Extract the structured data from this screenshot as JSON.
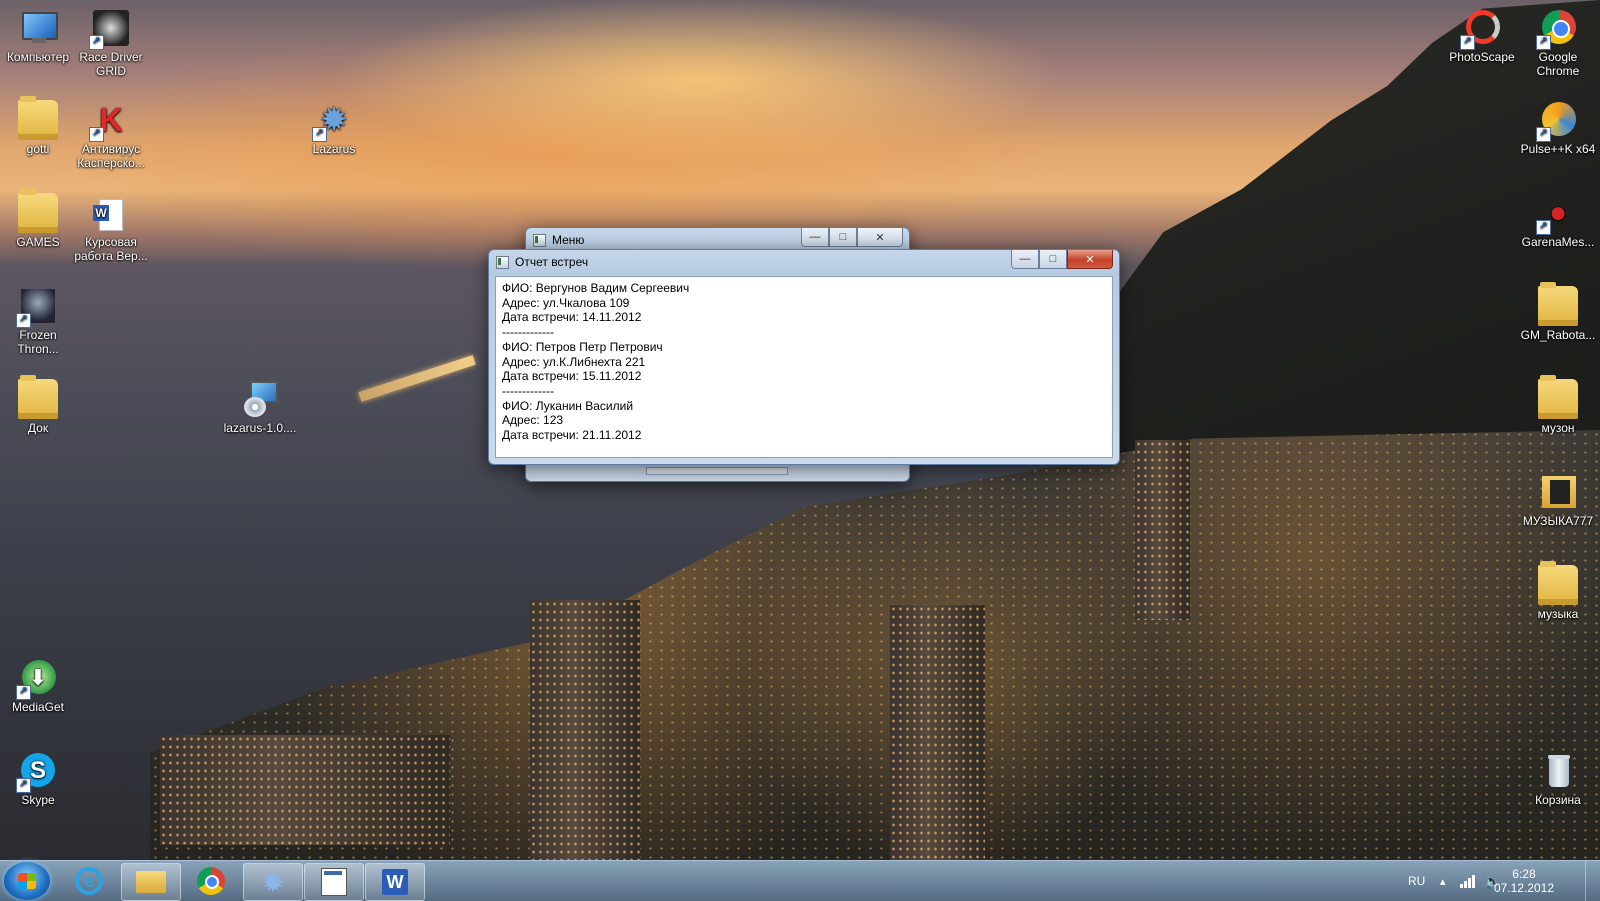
{
  "desktop": {
    "icons_left": [
      {
        "label": "Компьютер"
      },
      {
        "label": "Race Driver GRID"
      },
      {
        "label": "gotti"
      },
      {
        "label": "Антивирус Касперско..."
      },
      {
        "label": "Lazarus"
      },
      {
        "label": "GAMES"
      },
      {
        "label": "Курсовая работа Вер..."
      },
      {
        "label": "Frozen Thron..."
      },
      {
        "label": "Док"
      },
      {
        "label": "lazarus-1.0...."
      },
      {
        "label": "MediaGet"
      },
      {
        "label": "Skype"
      }
    ],
    "icons_right": [
      {
        "label": "PhotoScape"
      },
      {
        "label": "Google Chrome"
      },
      {
        "label": "Pulse++K x64"
      },
      {
        "label": "GarenaMes..."
      },
      {
        "label": "GM_Rabota..."
      },
      {
        "label": "музон"
      },
      {
        "label": "МУЗЫКА777"
      },
      {
        "label": "музыка"
      },
      {
        "label": "Корзина"
      }
    ]
  },
  "window_menu": {
    "title": "Меню"
  },
  "window_report": {
    "title": "Отчет встреч",
    "lines": [
      "ФИО: Вергунов Вадим Сергеевич",
      "Адрес: ул.Чкалова 109",
      "Дата встречи: 14.11.2012",
      "-------------",
      "ФИО: Петров Петр Петрович",
      "Адрес: ул.К.Либнехта 221",
      "Дата встречи: 15.11.2012",
      "-------------",
      "ФИО: Луканин Василий",
      "Адрес: 123",
      "Дата встречи: 21.11.2012"
    ]
  },
  "window_controls": {
    "minimize": "—",
    "maximize": "□",
    "close": "✕"
  },
  "taskbar": {
    "pinned": [
      "start-orb",
      "ie-icon",
      "explorer-icon",
      "chrome-icon",
      "lazarus-icon",
      "form-app-icon",
      "word-icon"
    ],
    "tray": {
      "language": "RU",
      "up_arrow": "▴",
      "time": "6:28",
      "date": "07.12.2012"
    }
  },
  "colors": {
    "close_red": "#c4412a",
    "window_frame": "#b6cae2",
    "taskbar": "#4f7090"
  }
}
